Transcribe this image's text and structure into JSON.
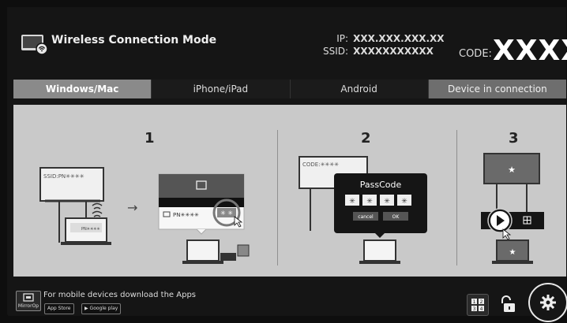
{
  "header": {
    "title": "Wireless Connection Mode",
    "ip_label": "IP:",
    "ip_value": "XXX.XXX.XXX.XX",
    "ssid_label": "SSID:",
    "ssid_value": "XXXXXXXXXXX",
    "code_label": "CODE:",
    "code_value": "XXXX"
  },
  "tabs": [
    {
      "label": "Windows/Mac",
      "active": true
    },
    {
      "label": "iPhone/iPad",
      "active": false
    },
    {
      "label": "Android",
      "active": false
    },
    {
      "label": "Device in connection",
      "active": false
    }
  ],
  "steps": {
    "step1": {
      "number": "1",
      "screen_ssid": "SSID:PN✳✳✳✳",
      "laptop_text": "PN✳✳✳✳",
      "popup_network": "PN✳✳✳✳",
      "popup_password": "✳ ✳"
    },
    "step2": {
      "number": "2",
      "screen_code": "CODE:✳✳✳✳",
      "dialog_title": "PassCode",
      "dialog_digits": [
        "✳",
        "✳",
        "✳",
        "✳"
      ],
      "cancel_label": "cancel",
      "ok_label": "OK"
    },
    "step3": {
      "number": "3"
    }
  },
  "footer": {
    "download_text": "For mobile devices download the Apps",
    "logo_label": "MirrorOp",
    "app_store_label": "App Store",
    "google_play_label": "Google play",
    "grid_labels": [
      "1",
      "2",
      "3",
      "4"
    ]
  },
  "icons": {
    "app": "wireless-display-icon",
    "lock": "unlock-icon",
    "grid": "quad-split-icon",
    "settings": "gear-icon"
  }
}
